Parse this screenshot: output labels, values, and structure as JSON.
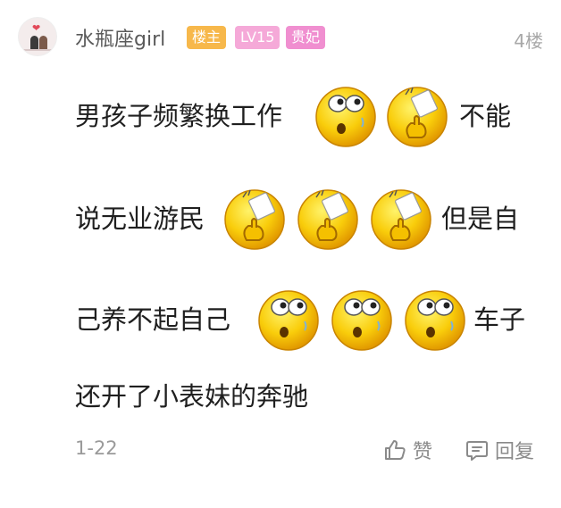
{
  "post": {
    "username": "水瓶座girl",
    "badges": {
      "owner": "楼主",
      "level": "LV15",
      "rank": "贵妃"
    },
    "floor": "4楼",
    "lines": [
      {
        "start": "男孩子频繁换工作",
        "end": "不能"
      },
      {
        "start": "说无业游民",
        "end": "但是自"
      },
      {
        "start": "己养不起自己",
        "end": "车子"
      },
      {
        "start": "还开了小表妹的奔驰"
      }
    ],
    "emojis": [
      "surprised-face-emoji",
      "thumbs-up-face-emoji",
      "thumbs-up-face-emoji",
      "thumbs-up-face-emoji",
      "thumbs-up-face-emoji",
      "surprised-face-emoji",
      "surprised-face-emoji",
      "surprised-face-emoji"
    ],
    "date": "1-22"
  },
  "actions": {
    "like_label": "赞",
    "reply_label": "回复"
  },
  "colors": {
    "owner_badge": "#f7b84b",
    "level_badge": "#f5a9d8",
    "rank_badge": "#f08fd0",
    "emoji_yellow": "#f7c300"
  }
}
